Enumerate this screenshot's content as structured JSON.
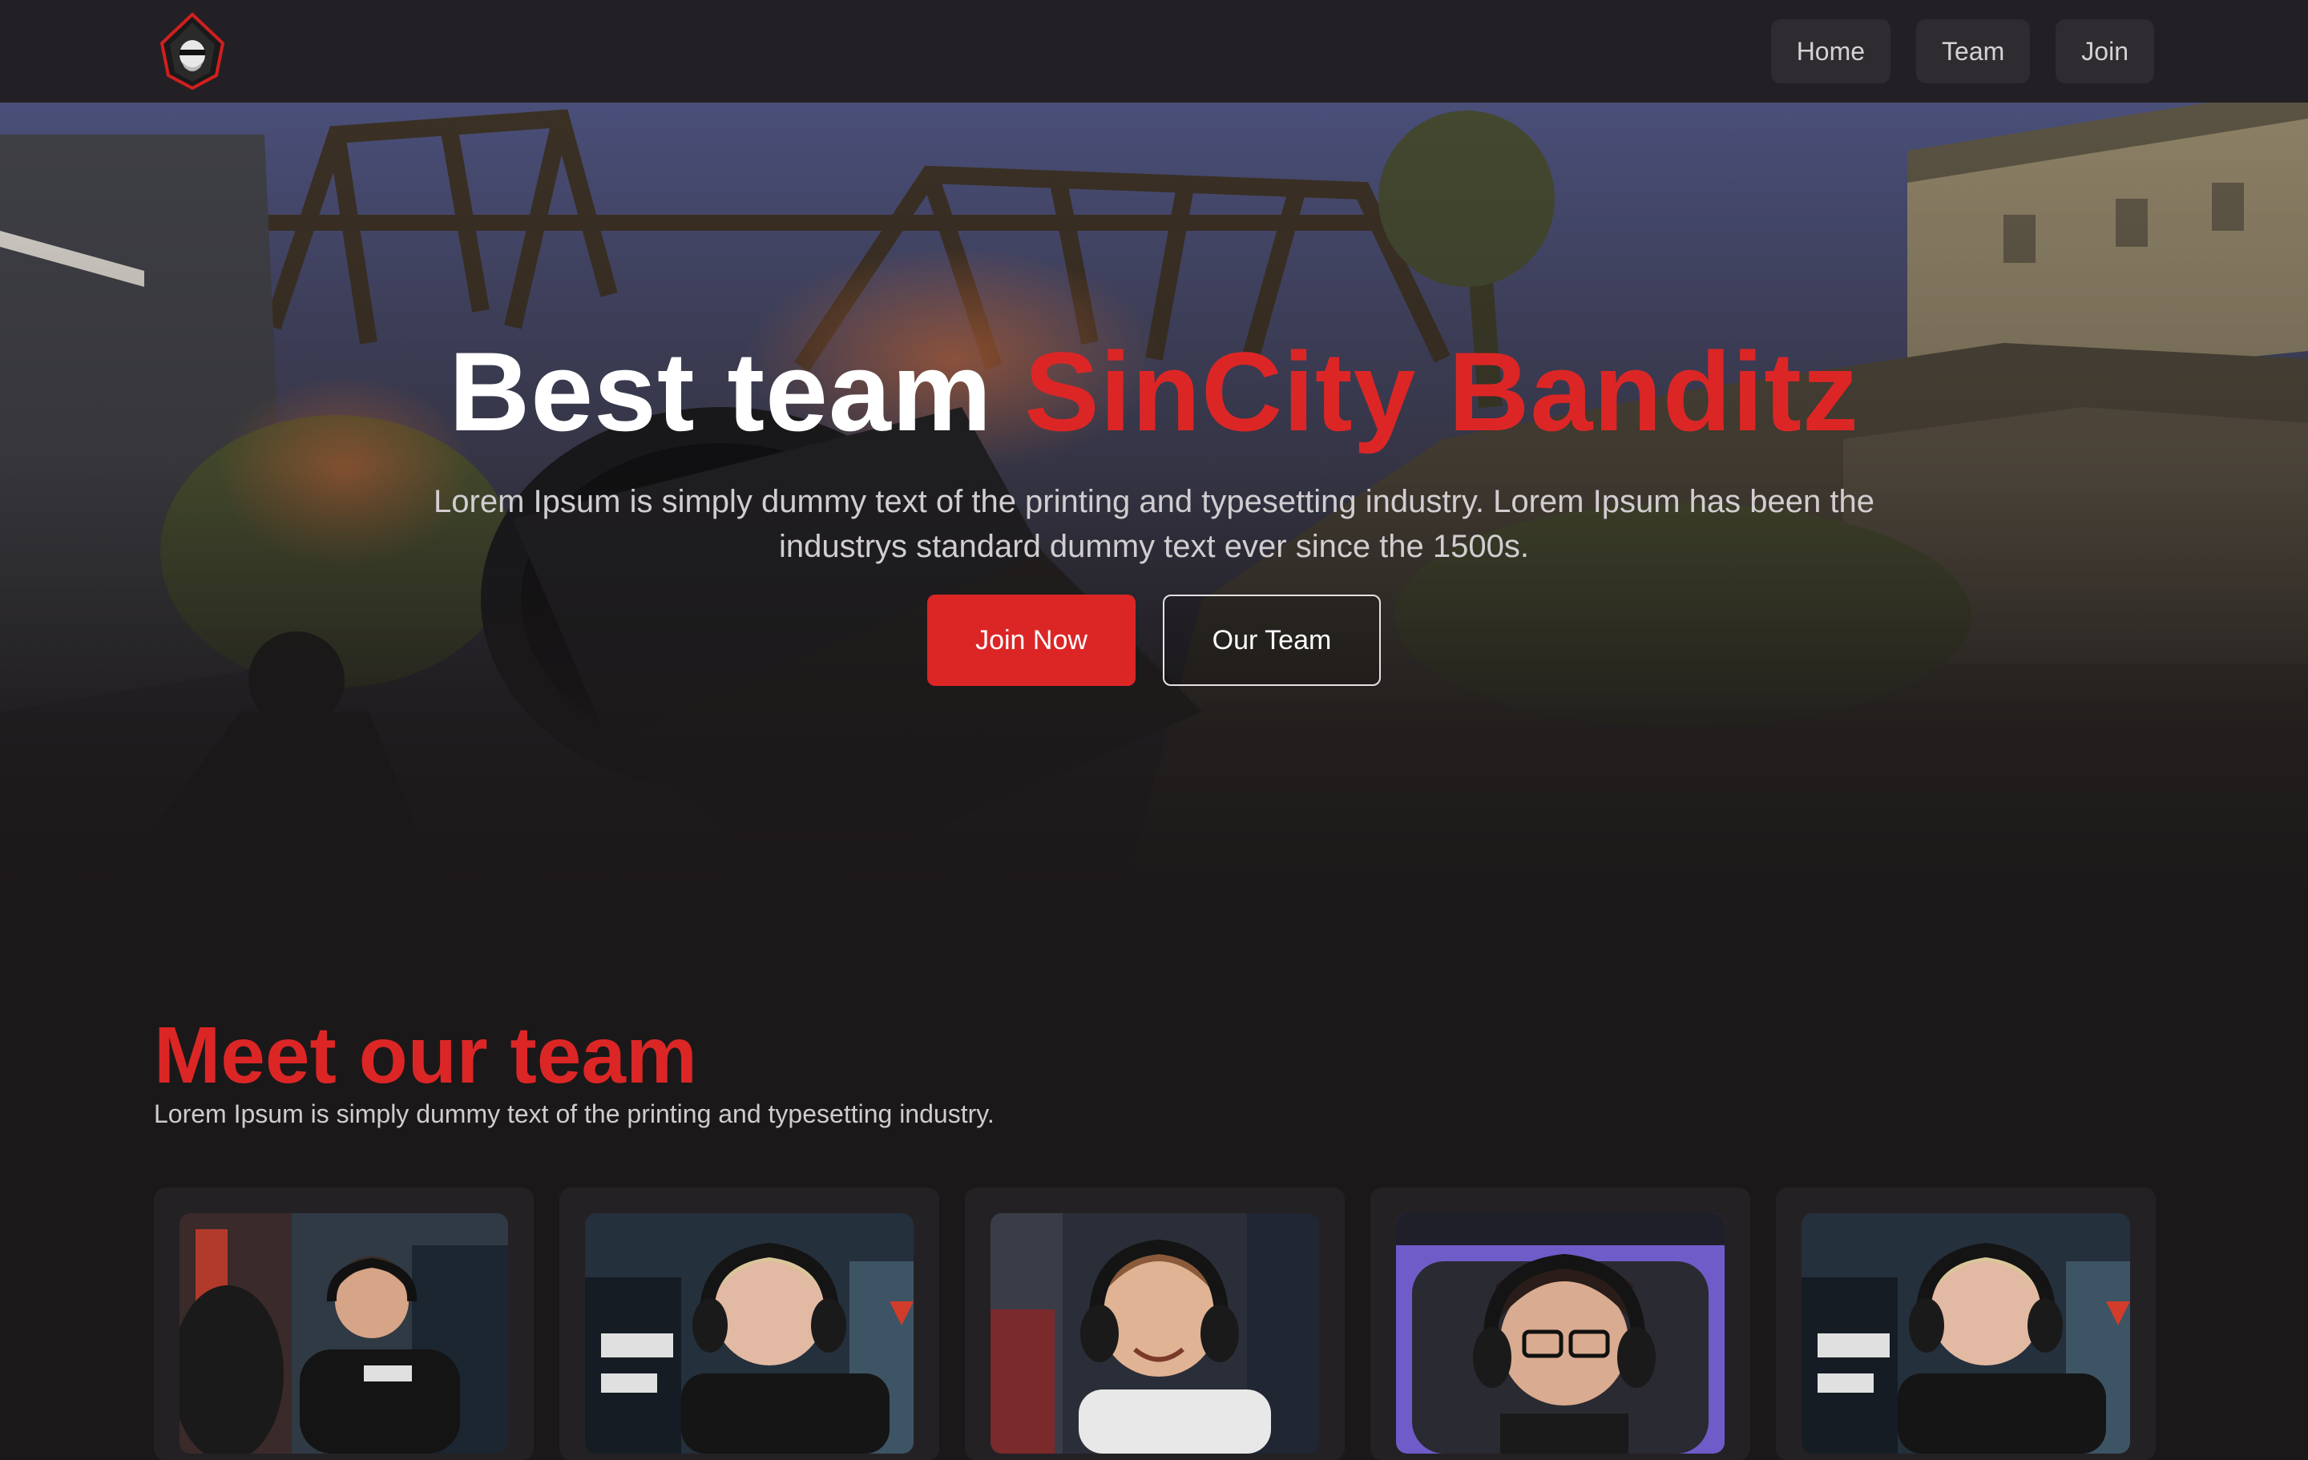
{
  "nav": {
    "logo_icon": "hooded-bandit-logo",
    "links": [
      {
        "label": "Home"
      },
      {
        "label": "Team"
      },
      {
        "label": "Join"
      }
    ]
  },
  "hero": {
    "title_prefix": "Best team ",
    "title_accent": "SinCity Banditz",
    "subtitle": "Lorem Ipsum is simply dummy text of the printing and typesetting industry. Lorem Ipsum has been the industrys standard dummy text ever since the 1500s.",
    "primary_button": "Join Now",
    "secondary_button": "Our Team"
  },
  "team": {
    "title": "Meet our team",
    "subtitle": "Lorem Ipsum is simply dummy text of the printing and typesetting industry.",
    "members": [
      {
        "photo_icon": "player-photo"
      },
      {
        "photo_icon": "player-photo"
      },
      {
        "photo_icon": "player-photo"
      },
      {
        "photo_icon": "player-photo"
      },
      {
        "photo_icon": "player-photo"
      }
    ]
  },
  "colors": {
    "accent": "#dc2626",
    "background": "#1b1819",
    "nav_background": "#222024",
    "card_background": "#242124"
  }
}
